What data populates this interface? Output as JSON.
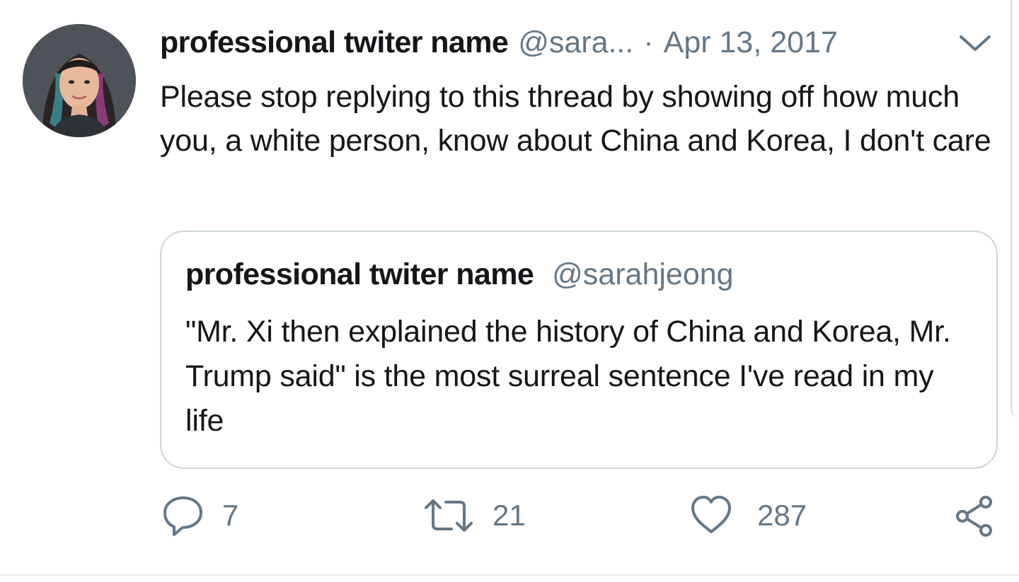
{
  "tweet": {
    "author_name": "professional twiter name",
    "author_handle": "@sara...",
    "separator": "·",
    "date": "Apr 13, 2017",
    "text": "Please stop replying to this thread by showing off how much you, a white person, know about China and Korea, I don't care",
    "avatar_icon": "profile-photo",
    "menu_icon": "chevron-down-icon"
  },
  "quoted_tweet": {
    "author_name": "professional twiter name",
    "author_handle": "@sarahjeong",
    "text": "\"Mr. Xi then explained the history of China and Korea, Mr. Trump said\" is the most surreal sentence I've read in my life"
  },
  "actions": {
    "reply": {
      "icon": "reply-icon",
      "count": "7"
    },
    "retweet": {
      "icon": "retweet-icon",
      "count": "21"
    },
    "like": {
      "icon": "heart-icon",
      "count": "287"
    },
    "share": {
      "icon": "share-icon"
    }
  },
  "colors": {
    "text": "#14171a",
    "secondary": "#657786",
    "border": "#ccd6dd"
  }
}
